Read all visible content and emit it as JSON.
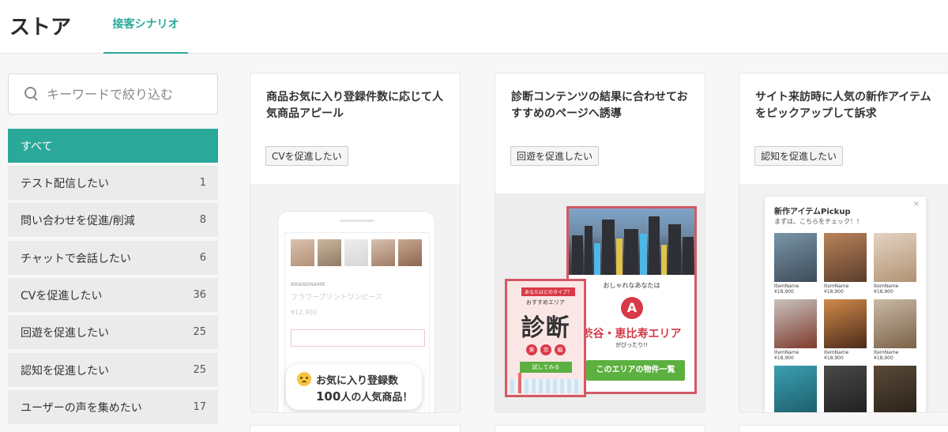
{
  "header": {
    "brand": "ストア",
    "tab_label": "接客シナリオ",
    "accent_color": "#2aa89a"
  },
  "search": {
    "placeholder": "キーワードで絞り込む",
    "icon": "search-icon"
  },
  "categories": [
    {
      "label": "すべて",
      "count": "",
      "active": true
    },
    {
      "label": "テスト配信したい",
      "count": "1"
    },
    {
      "label": "問い合わせを促進/削減",
      "count": "8"
    },
    {
      "label": "チャットで会話したい",
      "count": "6"
    },
    {
      "label": "CVを促進したい",
      "count": "36"
    },
    {
      "label": "回遊を促進したい",
      "count": "25"
    },
    {
      "label": "認知を促進したい",
      "count": "25"
    },
    {
      "label": "ユーザーの声を集めたい",
      "count": "17"
    }
  ],
  "cards": [
    {
      "title": "商品お気に入り登録件数に応じて人気商品アピール",
      "tag": "CVを促進したい",
      "preview": {
        "brand": "BRANDNAME",
        "product_name": "フラワープリントワンピース",
        "price": "¥12,900",
        "bubble_line1": "お気に入り登録数",
        "bubble_count": "100",
        "bubble_line2_suffix": "人の人気商品！"
      }
    },
    {
      "title": "診断コンテンツの結果に合わせておすすめのページへ誘導",
      "tag": "回遊を促進したい",
      "preview": {
        "result_intro": "おしゃれなあなたは",
        "result_letter": "A",
        "result_area": "渋谷・恵比寿エリア",
        "result_fit": "がぴったり!!",
        "result_button": "このエリアの物件一覧",
        "quiz_tag": "あなたはどのタイプ？",
        "quiz_sub": "おすすめエリア",
        "quiz_big": "診断",
        "quiz_chips": [
          "東",
          "京",
          "編"
        ],
        "quiz_button": "試してみる"
      }
    },
    {
      "title": "サイト来訪時に人気の新作アイテムをピックアップして訴求",
      "tag": "認知を促進したい",
      "preview": {
        "close": "×",
        "pickup_title": "新作アイテムPickup",
        "pickup_sub": "まずは、こちらをチェック！！",
        "items": [
          {
            "name": "ItemName",
            "price": "¥18,900"
          },
          {
            "name": "ItemName",
            "price": "¥18,900"
          },
          {
            "name": "ItemName",
            "price": "¥18,900"
          },
          {
            "name": "ItemName",
            "price": "¥18,900"
          },
          {
            "name": "ItemName",
            "price": "¥18,900"
          },
          {
            "name": "ItemName",
            "price": "¥18,900"
          },
          {
            "name": "",
            "price": ""
          },
          {
            "name": "",
            "price": ""
          },
          {
            "name": "",
            "price": ""
          }
        ]
      }
    }
  ]
}
